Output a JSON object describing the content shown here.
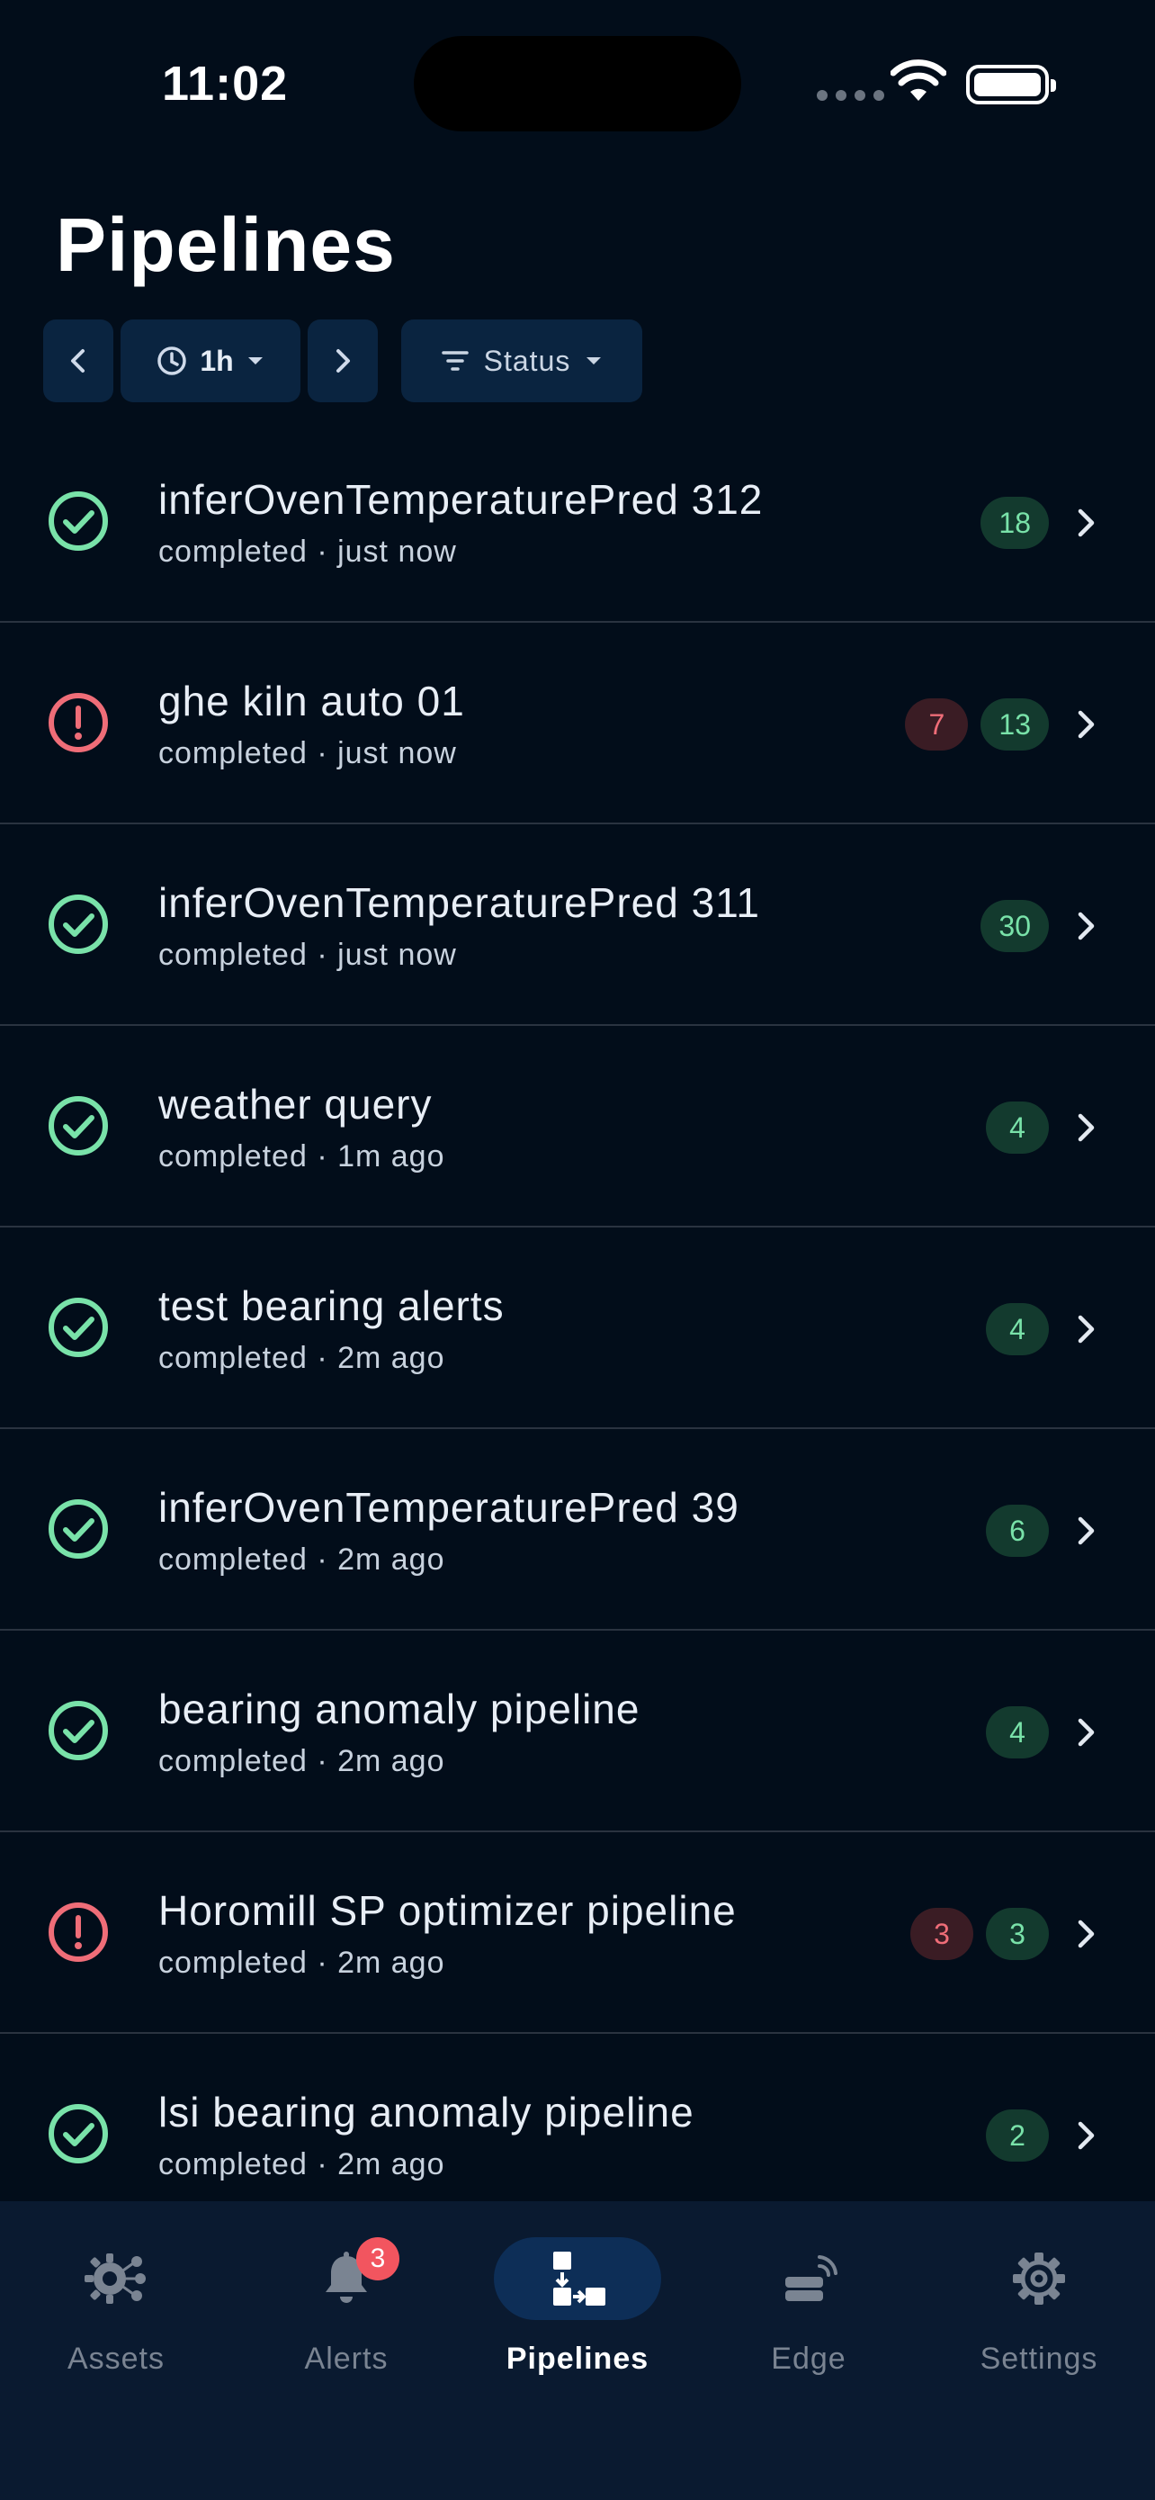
{
  "status_bar": {
    "time": "11:02"
  },
  "page": {
    "title": "Pipelines"
  },
  "filters": {
    "prev_icon": "chevron-left-icon",
    "range_label": "1h",
    "next_icon": "chevron-right-icon",
    "status_label": "Status"
  },
  "pipelines": [
    {
      "name": "inferOvenTemperaturePred 312",
      "meta": "completed · just now",
      "status": "success",
      "error_count": "",
      "success_count": "18"
    },
    {
      "name": "ghe kiln auto 01",
      "meta": "completed · just now",
      "status": "error",
      "error_count": "7",
      "success_count": "13"
    },
    {
      "name": "inferOvenTemperaturePred 311",
      "meta": "completed · just now",
      "status": "success",
      "error_count": "",
      "success_count": "30"
    },
    {
      "name": "weather query",
      "meta": "completed · 1m ago",
      "status": "success",
      "error_count": "",
      "success_count": "4"
    },
    {
      "name": "test bearing alerts",
      "meta": "completed · 2m ago",
      "status": "success",
      "error_count": "",
      "success_count": "4"
    },
    {
      "name": "inferOvenTemperaturePred 39",
      "meta": "completed · 2m ago",
      "status": "success",
      "error_count": "",
      "success_count": "6"
    },
    {
      "name": "bearing anomaly pipeline",
      "meta": "completed · 2m ago",
      "status": "success",
      "error_count": "",
      "success_count": "4"
    },
    {
      "name": "Horomill SP optimizer pipeline",
      "meta": "completed · 2m ago",
      "status": "error",
      "error_count": "3",
      "success_count": "3"
    },
    {
      "name": "lsi bearing anomaly pipeline",
      "meta": "completed · 2m ago",
      "status": "success",
      "error_count": "",
      "success_count": "2"
    }
  ],
  "tabbar": {
    "tabs": [
      {
        "label": "Assets",
        "icon": "assets-gear-icon"
      },
      {
        "label": "Alerts",
        "icon": "bell-icon",
        "badge": "3"
      },
      {
        "label": "Pipelines",
        "icon": "pipelines-icon"
      },
      {
        "label": "Edge",
        "icon": "edge-device-icon"
      },
      {
        "label": "Settings",
        "icon": "gear-icon"
      }
    ],
    "active": "Pipelines"
  },
  "colors": {
    "background": "#020d1a",
    "success": "#79e2a9",
    "error": "#ef6d78",
    "chip": "#0a2440",
    "tabbar": "#0a1a30"
  }
}
